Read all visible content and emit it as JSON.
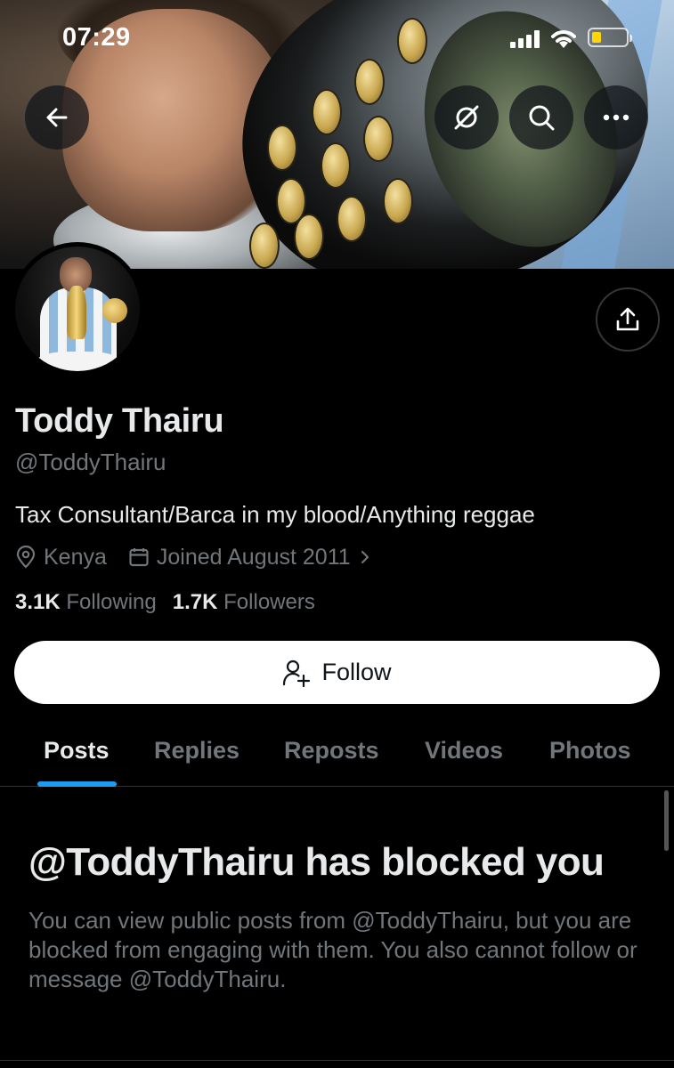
{
  "status_bar": {
    "time": "07:29"
  },
  "header_buttons": {
    "back": "back-arrow-icon",
    "grok": "grok-icon",
    "search": "search-icon",
    "more": "more-icon"
  },
  "profile": {
    "name": "Toddy Thairu",
    "handle": "@ToddyThairu",
    "bio": "Tax Consultant/Barca in my blood/Anything reggae",
    "location": "Kenya",
    "joined": "Joined August 2011",
    "following_count": "3.1K",
    "following_label": "Following",
    "followers_count": "1.7K",
    "followers_label": "Followers"
  },
  "follow_button": {
    "label": "Follow"
  },
  "tabs": [
    {
      "label": "Posts",
      "active": true
    },
    {
      "label": "Replies",
      "active": false
    },
    {
      "label": "Reposts",
      "active": false
    },
    {
      "label": "Videos",
      "active": false
    },
    {
      "label": "Photos",
      "active": false
    }
  ],
  "blocked": {
    "title": "@ToddyThairu has blocked you",
    "message": "You can view public posts from @ToddyThairu, but you are blocked from engaging with them. You also cannot follow or message @ToddyThairu."
  },
  "colors": {
    "background": "#000000",
    "primary_text": "#e7e9ea",
    "secondary_text": "#71767b",
    "accent": "#1d9bf0",
    "battery": "#ffd60a"
  }
}
